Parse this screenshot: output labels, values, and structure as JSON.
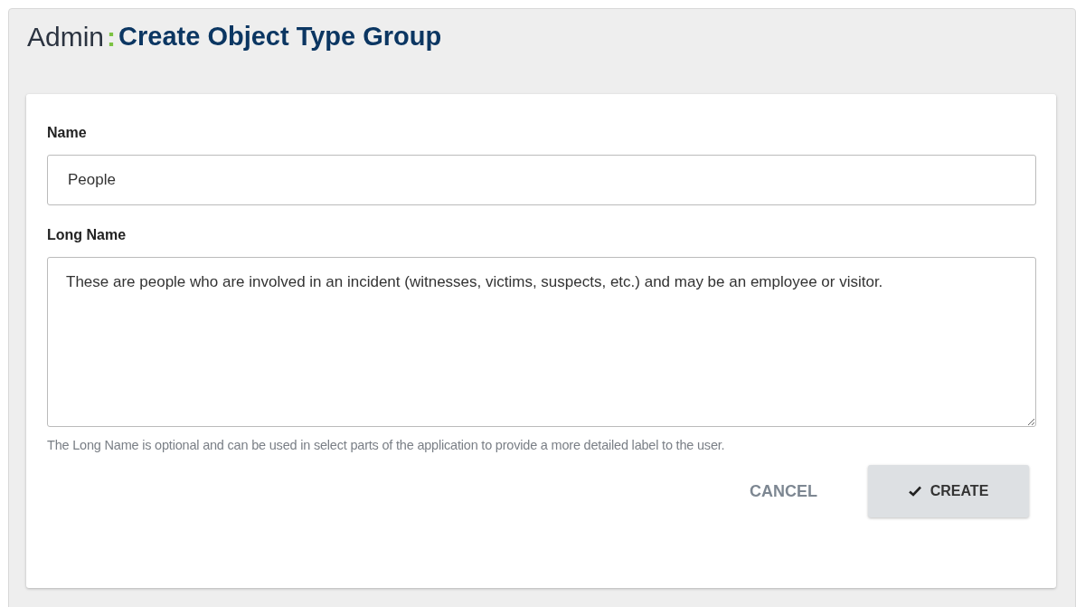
{
  "header": {
    "section": "Admin",
    "separator": ":",
    "title": "Create Object Type Group"
  },
  "form": {
    "fields": [
      {
        "kind": "input",
        "label": "Name",
        "value": "People"
      },
      {
        "kind": "textarea",
        "label": "Long Name",
        "value": "These are people who are involved in an incident (witnesses, victims, suspects, etc.) and may be an employee or visitor.",
        "hint": "The Long Name is optional and can be used in select parts of the application to provide a more detailed label to the user."
      }
    ],
    "buttons": [
      {
        "kind": "text",
        "label": "CANCEL"
      },
      {
        "kind": "primary",
        "label": "CREATE"
      }
    ]
  }
}
